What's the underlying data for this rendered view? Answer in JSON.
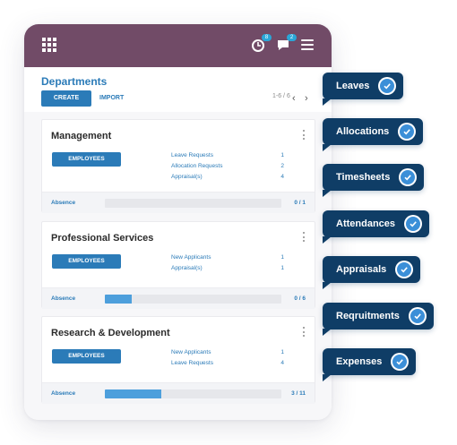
{
  "header": {
    "notifications_count": "8",
    "messages_count": "2"
  },
  "page": {
    "title": "Departments",
    "create_label": "CREATE",
    "import_label": "IMPORT",
    "pager": "1-6 / 6"
  },
  "cards": [
    {
      "title": "Management",
      "button": "EMPLOYEES",
      "stats": [
        {
          "label": "Leave Requests",
          "value": "1"
        },
        {
          "label": "Allocation Requests",
          "value": "2"
        },
        {
          "label": "Appraisal(s)",
          "value": "4"
        }
      ],
      "footer": {
        "label": "Absence",
        "count": "0 / 1",
        "progress": 0
      }
    },
    {
      "title": "Professional Services",
      "button": "EMPLOYEES",
      "stats": [
        {
          "label": "New Applicants",
          "value": "1"
        },
        {
          "label": "Appraisal(s)",
          "value": "1"
        }
      ],
      "footer": {
        "label": "Absence",
        "count": "0 / 6",
        "progress": 0.15
      }
    },
    {
      "title": "Research & Development",
      "button": "EMPLOYEES",
      "stats": [
        {
          "label": "New Applicants",
          "value": "1"
        },
        {
          "label": "Leave Requests",
          "value": "4"
        }
      ],
      "footer": {
        "label": "Absence",
        "count": "3 / 11",
        "progress": 0.32
      }
    }
  ],
  "features": [
    {
      "label": "Leaves"
    },
    {
      "label": "Allocations"
    },
    {
      "label": "Timesheets"
    },
    {
      "label": "Attendances"
    },
    {
      "label": "Appraisals"
    },
    {
      "label": "Reqruitments"
    },
    {
      "label": "Expenses"
    }
  ],
  "colors": {
    "topbar": "#714b67",
    "accent": "#2b7bb8",
    "tag": "#0f3d66",
    "check": "#3b8fd8"
  }
}
